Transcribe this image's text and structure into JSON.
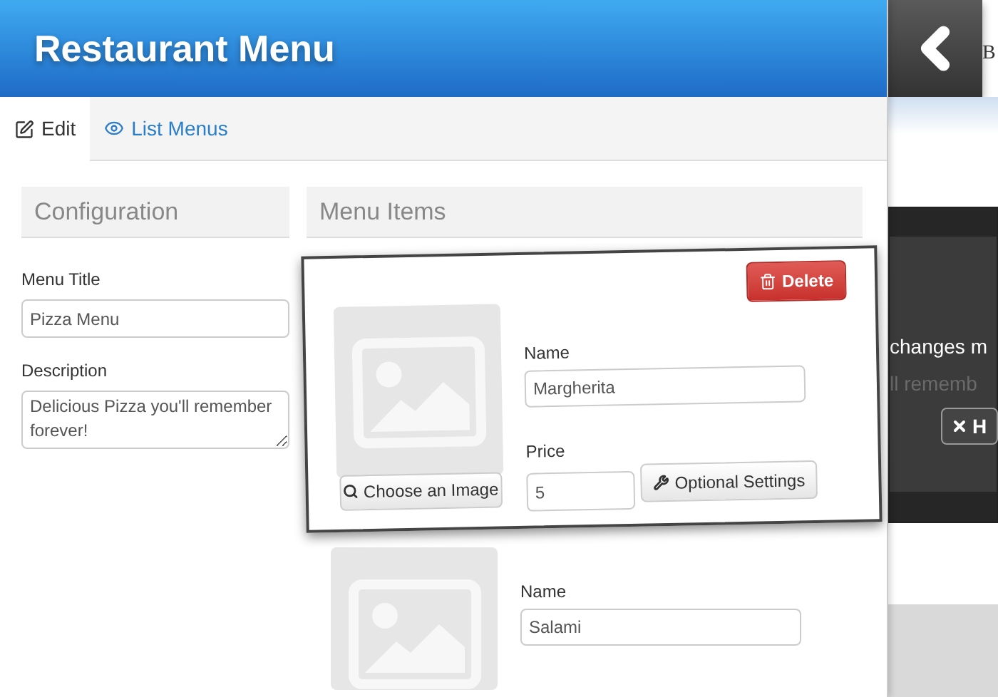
{
  "header": {
    "title": "Restaurant Menu"
  },
  "tabs": [
    {
      "label": "Edit",
      "selected": true
    },
    {
      "label": "List Menus",
      "selected": false
    }
  ],
  "configuration": {
    "heading": "Configuration",
    "fields": [
      {
        "label": "Menu Title",
        "value": "Pizza Menu",
        "kind": "input"
      },
      {
        "label": "Description",
        "value": "Delicious Pizza you'll remember forever!",
        "kind": "textarea"
      }
    ]
  },
  "menu_items": {
    "heading": "Menu Items",
    "items": [
      {
        "floating": true,
        "delete_label": "Delete",
        "choose_image_label": "Choose an Image",
        "name_label": "Name",
        "name": "Margherita",
        "price_label": "Price",
        "price": "5",
        "settings_label": "Optional Settings"
      },
      {
        "floating": false,
        "name_label": "Name",
        "name": "Salami"
      }
    ]
  },
  "background_page": {
    "letter": "B",
    "overlay_lines": [
      "changes m",
      "ll rememb"
    ],
    "button_label": "H"
  }
}
